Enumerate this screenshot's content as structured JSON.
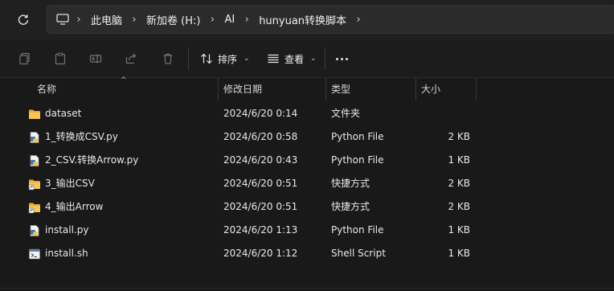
{
  "address_bar": {
    "crumbs": [
      "此电脑",
      "新加卷 (H:)",
      "AI",
      "hunyuan转换脚本"
    ]
  },
  "toolbar": {
    "sort_label": "排序",
    "view_label": "查看"
  },
  "columns": {
    "name": "名称",
    "date": "修改日期",
    "type": "类型",
    "size": "大小"
  },
  "files": [
    {
      "name": "dataset",
      "date": "2024/6/20 0:14",
      "type": "文件夹",
      "size": "",
      "icon": "folder-icon"
    },
    {
      "name": "1_转换成CSV.py",
      "date": "2024/6/20 0:58",
      "type": "Python File",
      "size": "2 KB",
      "icon": "python-file-icon"
    },
    {
      "name": "2_CSV.转换Arrow.py",
      "date": "2024/6/20 0:43",
      "type": "Python File",
      "size": "1 KB",
      "icon": "python-file-icon"
    },
    {
      "name": "3_输出CSV",
      "date": "2024/6/20 0:51",
      "type": "快捷方式",
      "size": "2 KB",
      "icon": "folder-shortcut-icon"
    },
    {
      "name": "4_输出Arrow",
      "date": "2024/6/20 0:51",
      "type": "快捷方式",
      "size": "2 KB",
      "icon": "folder-shortcut-icon"
    },
    {
      "name": "install.py",
      "date": "2024/6/20 1:13",
      "type": "Python File",
      "size": "1 KB",
      "icon": "python-file-icon"
    },
    {
      "name": "install.sh",
      "date": "2024/6/20 1:12",
      "type": "Shell Script",
      "size": "1 KB",
      "icon": "shell-script-icon"
    }
  ],
  "colors": {
    "background": "#191919",
    "folder": "#f4c04e",
    "text": "#e8e8e8"
  }
}
